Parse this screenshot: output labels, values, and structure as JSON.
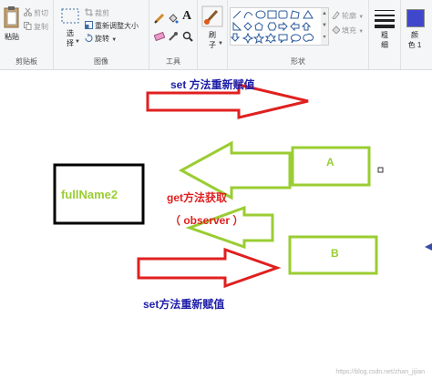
{
  "ribbon": {
    "clipboard": {
      "paste_label": "粘贴",
      "cut_label": "剪切",
      "copy_label": "复制",
      "group_label": "剪贴板"
    },
    "image": {
      "select_label_1": "选",
      "select_label_2": "择",
      "crop_label": "裁剪",
      "resize_label": "重新调整大小",
      "rotate_label": "旋转",
      "group_label": "图像"
    },
    "tools": {
      "text_tool_glyph": "A",
      "group_label": "工具"
    },
    "brushes": {
      "label_1": "刷",
      "label_2": "子"
    },
    "shapes": {
      "outline_label": "轮廓",
      "fill_label": "填充",
      "group_label": "形状"
    },
    "size": {
      "label_1": "粗",
      "label_2": "细"
    },
    "colors": {
      "color1_label_1": "颜",
      "color1_label_2": "色 1",
      "color1_value": "#3f48cc"
    }
  },
  "canvas": {
    "top_label": "set 方法重新赋值",
    "box_left_label": "fullName2",
    "box_a_label": "A",
    "box_b_label": "B",
    "get_label": "get方法获取",
    "observer_label": "（ observer ）",
    "bottom_label": "set方法重新赋值",
    "watermark": "https://blog.csdn.net/zhan_jijian",
    "colors": {
      "red": "#e02020",
      "green": "#9acd32",
      "black": "#000000",
      "blue_text": "#2020a8"
    }
  }
}
